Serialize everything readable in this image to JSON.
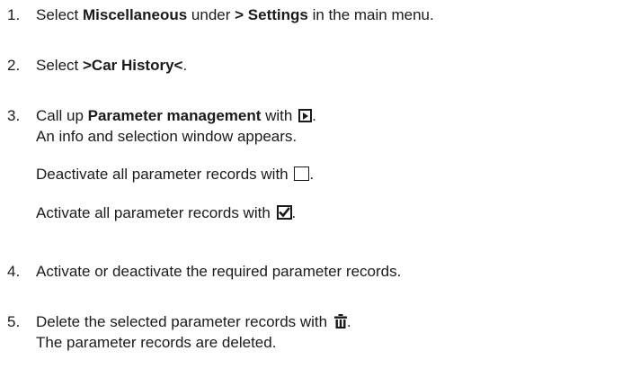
{
  "steps": [
    {
      "number": "1.",
      "pre": "Select ",
      "bold1": "Miscellaneous",
      "mid": " under ",
      "bold2": "> Settings",
      "post": " in the main menu."
    },
    {
      "number": "2.",
      "pre": "Select ",
      "bold1": ">Car History<",
      "post": "."
    },
    {
      "number": "3.",
      "pre": "Call up ",
      "bold1": "Parameter management",
      "mid": " with ",
      "icon": "play-button-icon",
      "post": ".",
      "line2": "An info and selection window appears.",
      "note1_pre": "Deactivate all parameter records with ",
      "note1_icon": "empty-checkbox-icon",
      "note1_post": ".",
      "note2_pre": "Activate all parameter records with ",
      "note2_icon": "checked-checkbox-icon",
      "note2_post": "."
    },
    {
      "number": "4.",
      "text": "Activate or deactivate the required parameter records."
    },
    {
      "number": "5.",
      "pre": "Delete the selected parameter records with ",
      "icon": "trash-icon",
      "post": ".",
      "line2": "The parameter records are deleted."
    }
  ]
}
